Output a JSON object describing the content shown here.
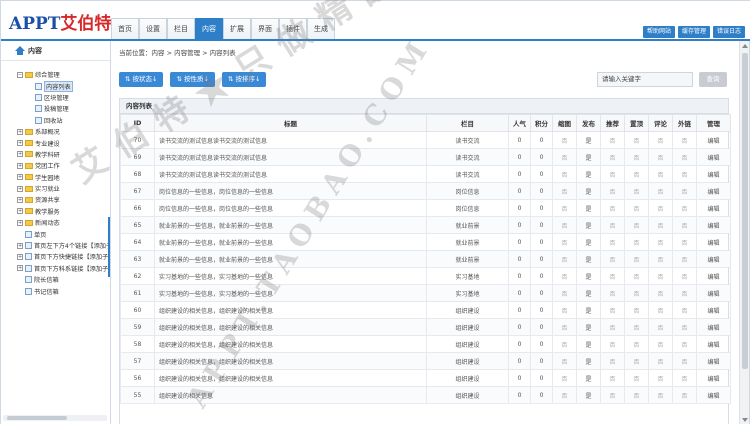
{
  "header": {
    "logo_en": "APPT",
    "logo_cn": "艾伯特",
    "nav": [
      "首页",
      "设置",
      "栏目",
      "内容",
      "扩展",
      "界面",
      "插件",
      "生成"
    ],
    "active_nav": "内容",
    "top_links": [
      "帮助网站",
      "缓存管理",
      "错误日志"
    ]
  },
  "sidebar": {
    "title": "内容",
    "items": [
      {
        "label": "综合管理",
        "type": "folder",
        "level": 0,
        "sign": "−"
      },
      {
        "label": "内容列表",
        "type": "doc",
        "level": 1,
        "selected": true
      },
      {
        "label": "区块管理",
        "type": "doc",
        "level": 1
      },
      {
        "label": "投稿管理",
        "type": "doc",
        "level": 1
      },
      {
        "label": "回收站",
        "type": "doc",
        "level": 1
      },
      {
        "label": "系部概况",
        "type": "folder",
        "level": 0,
        "sign": "+"
      },
      {
        "label": "专业建设",
        "type": "folder",
        "level": 0,
        "sign": "+"
      },
      {
        "label": "教学科研",
        "type": "folder",
        "level": 0,
        "sign": "+"
      },
      {
        "label": "党团工作",
        "type": "folder",
        "level": 0,
        "sign": "+"
      },
      {
        "label": "学生园地",
        "type": "folder",
        "level": 0,
        "sign": "+"
      },
      {
        "label": "实习就业",
        "type": "folder",
        "level": 0,
        "sign": "+"
      },
      {
        "label": "资源共享",
        "type": "folder",
        "level": 0,
        "sign": "+"
      },
      {
        "label": "教学服务",
        "type": "folder",
        "level": 0,
        "sign": "+"
      },
      {
        "label": "新闻动态",
        "type": "folder",
        "level": 0,
        "sign": "+"
      },
      {
        "label": "单页",
        "type": "doc",
        "level": "0p"
      },
      {
        "label": "首页左下方4个链接【添加子",
        "type": "doc",
        "level": 0,
        "sign": "+"
      },
      {
        "label": "首页下方快捷链接【添加子",
        "type": "doc",
        "level": 0,
        "sign": "+"
      },
      {
        "label": "首页下方科系链接【添加子",
        "type": "doc",
        "level": 0,
        "sign": "+"
      },
      {
        "label": "院长信箱",
        "type": "doc",
        "level": "0p"
      },
      {
        "label": "书记信箱",
        "type": "doc",
        "level": "0p"
      }
    ]
  },
  "main": {
    "breadcrumb": "当前位置：内容 > 内容管理 > 内容列表",
    "buttons": [
      "⇅ 按状态↓",
      "⇅ 按性质↓",
      "⇅ 按排序↓"
    ],
    "search_placeholder": "请输入关键字",
    "search_button": "查询",
    "panel_title": "内容列表",
    "columns": [
      "ID",
      "标题",
      "栏目",
      "人气",
      "积分",
      "缩图",
      "发布",
      "推荐",
      "置顶",
      "评论",
      "外链",
      "管理"
    ],
    "rows": [
      {
        "id": "70",
        "title": "读书交流的测试信息读书交流的测试信息",
        "cat": "读书交流",
        "pop": "0",
        "score": "0",
        "thumb": "否",
        "pub": "是",
        "rec": "否",
        "top": "否",
        "cmt": "否",
        "link": "否",
        "op": "编辑"
      },
      {
        "id": "69",
        "title": "读书交流的测试信息读书交流的测试信息",
        "cat": "读书交流",
        "pop": "0",
        "score": "0",
        "thumb": "否",
        "pub": "是",
        "rec": "否",
        "top": "否",
        "cmt": "否",
        "link": "否",
        "op": "编辑"
      },
      {
        "id": "68",
        "title": "读书交流的测试信息读书交流的测试信息",
        "cat": "读书交流",
        "pop": "0",
        "score": "0",
        "thumb": "否",
        "pub": "是",
        "rec": "否",
        "top": "否",
        "cmt": "否",
        "link": "否",
        "op": "编辑"
      },
      {
        "id": "67",
        "title": "岗位信息的一些信息，岗位信息的一些信息",
        "cat": "岗位信息",
        "pop": "0",
        "score": "0",
        "thumb": "否",
        "pub": "是",
        "rec": "否",
        "top": "否",
        "cmt": "否",
        "link": "否",
        "op": "编辑"
      },
      {
        "id": "66",
        "title": "岗位信息的一些信息，岗位信息的一些信息",
        "cat": "岗位信息",
        "pop": "0",
        "score": "0",
        "thumb": "否",
        "pub": "是",
        "rec": "否",
        "top": "否",
        "cmt": "否",
        "link": "否",
        "op": "编辑"
      },
      {
        "id": "65",
        "title": "就业前景的一些信息，就业前景的一些信息",
        "cat": "就业前景",
        "pop": "0",
        "score": "0",
        "thumb": "否",
        "pub": "是",
        "rec": "否",
        "top": "否",
        "cmt": "否",
        "link": "否",
        "op": "编辑"
      },
      {
        "id": "64",
        "title": "就业前景的一些信息，就业前景的一些信息",
        "cat": "就业前景",
        "pop": "0",
        "score": "0",
        "thumb": "否",
        "pub": "是",
        "rec": "否",
        "top": "否",
        "cmt": "否",
        "link": "否",
        "op": "编辑"
      },
      {
        "id": "63",
        "title": "就业前景的一些信息，就业前景的一些信息",
        "cat": "就业前景",
        "pop": "0",
        "score": "0",
        "thumb": "否",
        "pub": "是",
        "rec": "否",
        "top": "否",
        "cmt": "否",
        "link": "否",
        "op": "编辑"
      },
      {
        "id": "62",
        "title": "实习基地的一些信息，实习基地的一些信息",
        "cat": "实习基地",
        "pop": "0",
        "score": "0",
        "thumb": "否",
        "pub": "是",
        "rec": "否",
        "top": "否",
        "cmt": "否",
        "link": "否",
        "op": "编辑"
      },
      {
        "id": "61",
        "title": "实习基地的一些信息，实习基地的一些信息",
        "cat": "实习基地",
        "pop": "0",
        "score": "0",
        "thumb": "否",
        "pub": "是",
        "rec": "否",
        "top": "否",
        "cmt": "否",
        "link": "否",
        "op": "编辑"
      },
      {
        "id": "60",
        "title": "组织建设的相关信息，组织建设的相关信息",
        "cat": "组织建设",
        "pop": "0",
        "score": "0",
        "thumb": "否",
        "pub": "是",
        "rec": "否",
        "top": "否",
        "cmt": "否",
        "link": "否",
        "op": "编辑"
      },
      {
        "id": "59",
        "title": "组织建设的相关信息，组织建设的相关信息",
        "cat": "组织建设",
        "pop": "0",
        "score": "0",
        "thumb": "否",
        "pub": "是",
        "rec": "否",
        "top": "否",
        "cmt": "否",
        "link": "否",
        "op": "编辑"
      },
      {
        "id": "58",
        "title": "组织建设的相关信息，组织建设的相关信息",
        "cat": "组织建设",
        "pop": "0",
        "score": "0",
        "thumb": "否",
        "pub": "是",
        "rec": "否",
        "top": "否",
        "cmt": "否",
        "link": "否",
        "op": "编辑"
      },
      {
        "id": "57",
        "title": "组织建设的相关信息，组织建设的相关信息",
        "cat": "组织建设",
        "pop": "0",
        "score": "0",
        "thumb": "否",
        "pub": "是",
        "rec": "否",
        "top": "否",
        "cmt": "否",
        "link": "否",
        "op": "编辑"
      },
      {
        "id": "56",
        "title": "组织建设的相关信息，组织建设的相关信息",
        "cat": "组织建设",
        "pop": "0",
        "score": "0",
        "thumb": "否",
        "pub": "是",
        "rec": "否",
        "top": "否",
        "cmt": "否",
        "link": "否",
        "op": "编辑"
      },
      {
        "id": "55",
        "title": "组织建设的相关信息",
        "cat": "组织建设",
        "pop": "0",
        "score": "0",
        "thumb": "否",
        "pub": "是",
        "rec": "否",
        "top": "否",
        "cmt": "否",
        "link": "否",
        "op": "编辑"
      }
    ]
  },
  "watermark": {
    "line1": "艾伯特★只做精品",
    "line2": "APPT.TAOBAO.COM"
  },
  "colors": {
    "accent": "#2f7fc8",
    "button": "#3a89d6",
    "logo_blue": "#1b4fa8",
    "logo_red": "#d8282a"
  }
}
